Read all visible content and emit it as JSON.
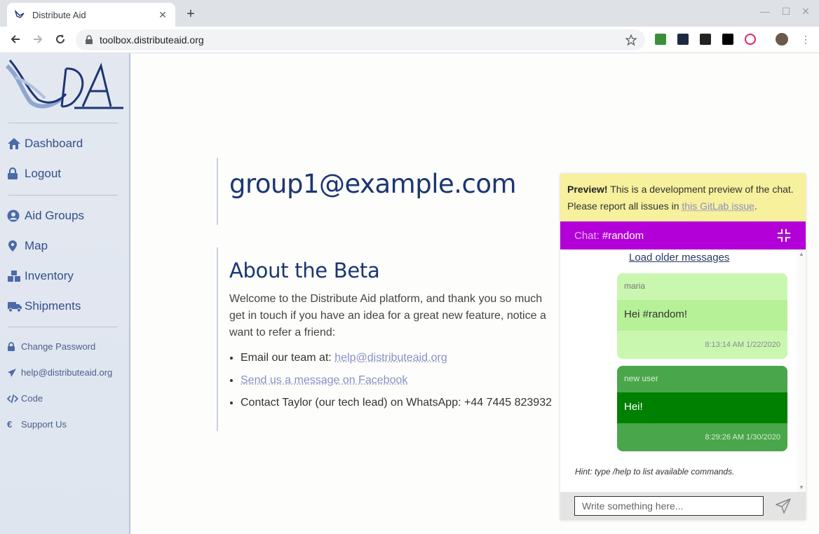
{
  "browser": {
    "tab_title": "Distribute Aid",
    "tab_close": "✕",
    "new_tab": "+",
    "url": "toolbox.distributeaid.org"
  },
  "sidebar": {
    "nav": [
      {
        "label": "Dashboard",
        "icon": "home-icon"
      },
      {
        "label": "Logout",
        "icon": "lock-icon"
      },
      {
        "label": "Aid Groups",
        "icon": "user-icon"
      },
      {
        "label": "Map",
        "icon": "map-marker-icon"
      },
      {
        "label": "Inventory",
        "icon": "boxes-icon"
      },
      {
        "label": "Shipments",
        "icon": "truck-icon"
      }
    ],
    "sub": [
      {
        "label": "Change Password",
        "icon": "lock-icon"
      },
      {
        "label": "help@distributeaid.org",
        "icon": "paper-plane-icon"
      },
      {
        "label": "Code",
        "icon": "code-icon"
      },
      {
        "label": "Support Us",
        "icon": "euro-icon"
      }
    ]
  },
  "main": {
    "email_heading": "group1@example.com",
    "about_heading": "About the Beta",
    "para_line1": "Welcome to the Distribute Aid platform, and thank you so much",
    "para_line2": "get in touch if you have an idea for a great new feature, notice a",
    "para_line3": "want to refer a friend:",
    "list": {
      "item1_prefix": "Email our team at: ",
      "item1_link": "help@distributeaid.org",
      "item2_link": "Send us a message on Facebook",
      "item3": "Contact Taylor (our tech lead) on WhatsApp: +44 7445 823932"
    }
  },
  "chat": {
    "preview_bold": "Preview!",
    "preview_text": " This is a development preview of the chat. Please report all issues in ",
    "preview_link": "this GitLab issue",
    "preview_end": ".",
    "header_label": "Chat:",
    "channel": "#random",
    "load_older": "Load older messages",
    "messages": [
      {
        "user": "maria",
        "text": "Hei #random!",
        "time": "8:13:14 AM 1/22/2020"
      },
      {
        "user": "new user",
        "text": "Hei!",
        "time": "8:29:26 AM 1/30/2020"
      }
    ],
    "hint": "Hint: type /help to list available commands.",
    "input_placeholder": "Write something here..."
  },
  "colors": {
    "brand_blue": "#1c3573",
    "chat_header": "#b300d8",
    "preview_bg": "#f7f09c",
    "own_bubble": "#008000"
  }
}
